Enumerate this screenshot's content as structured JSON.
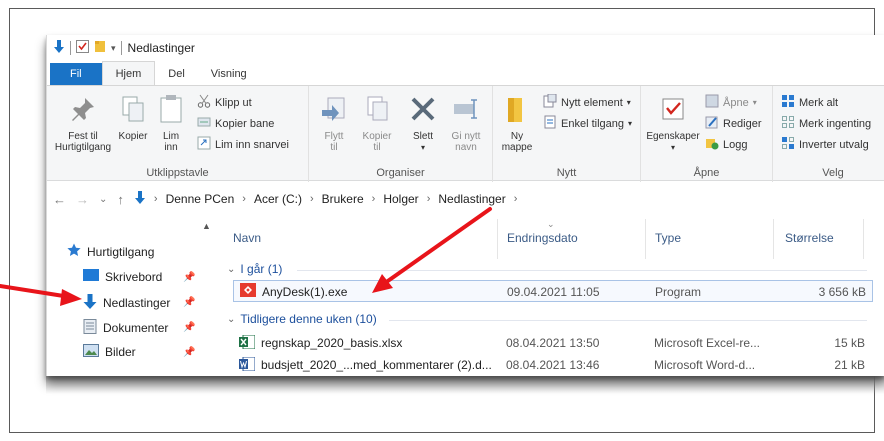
{
  "window": {
    "title": "Nedlastinger"
  },
  "ribbon_tabs": [
    "Fil",
    "Hjem",
    "Del",
    "Visning"
  ],
  "ribbon": {
    "clipboard": {
      "pin": "Fest til\nHurtigtilgang",
      "copy": "Kopier",
      "paste": "Lim\ninn",
      "cut": "Klipp ut",
      "copy_path": "Kopier bane",
      "paste_shortcut": "Lim inn snarvei",
      "label": "Utklippstavle"
    },
    "organize": {
      "move": "Flytt\ntil",
      "copy_to": "Kopier\ntil",
      "delete": "Slett",
      "rename": "Gi nytt\nnavn",
      "label": "Organiser"
    },
    "new": {
      "new_folder": "Ny\nmappe",
      "new_item": "Nytt element",
      "easy_access": "Enkel tilgang",
      "label": "Nytt"
    },
    "open": {
      "properties": "Egenskaper",
      "open": "Åpne",
      "edit": "Rediger",
      "history": "Logg",
      "label": "Åpne"
    },
    "select": {
      "select_all": "Merk alt",
      "select_none": "Merk ingenting",
      "invert": "Inverter utvalg",
      "label": "Velg"
    }
  },
  "address": {
    "crumbs": [
      "Denne PCen",
      "Acer (C:)",
      "Brukere",
      "Holger",
      "Nedlastinger"
    ]
  },
  "nav_pane": {
    "items": [
      {
        "label": "Hurtigtilgang",
        "icon": "star-icon"
      },
      {
        "label": "Skrivebord",
        "icon": "desktop-icon"
      },
      {
        "label": "Nedlastinger",
        "icon": "download-icon"
      },
      {
        "label": "Dokumenter",
        "icon": "documents-icon"
      },
      {
        "label": "Bilder",
        "icon": "pictures-icon"
      }
    ]
  },
  "columns": {
    "name": "Navn",
    "date": "Endringsdato",
    "type": "Type",
    "size": "Størrelse"
  },
  "groups": [
    {
      "label": "I går (1)",
      "rows": [
        {
          "name": "AnyDesk(1).exe",
          "date": "09.04.2021 11:05",
          "type": "Program",
          "size": "3 656 kB"
        }
      ]
    },
    {
      "label": "Tidligere denne uken (10)",
      "rows": [
        {
          "name": "regnskap_2020_basis.xlsx",
          "date": "08.04.2021 13:50",
          "type": "Microsoft Excel-re...",
          "size": "15 kB"
        },
        {
          "name": "budsjett_2020_...med_kommentarer (2).d...",
          "date": "08.04.2021 13:46",
          "type": "Microsoft Word-d...",
          "size": "21 kB"
        }
      ]
    }
  ],
  "colors": {
    "accent": "#1a73c6",
    "annotation": "#e8141a"
  }
}
